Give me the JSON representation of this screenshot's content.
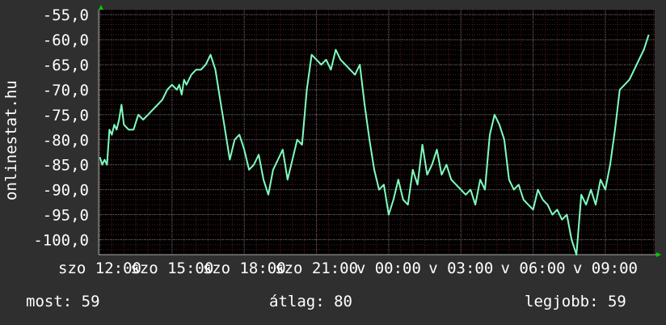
{
  "chart_data": {
    "type": "line",
    "ylabel": "onlinestat.hu",
    "y_ticks": [
      "-55,0",
      "-60,0",
      "-65,0",
      "-70,0",
      "-75,0",
      "-80,0",
      "-85,0",
      "-90,0",
      "-95,0",
      "-100,0"
    ],
    "y_tick_values": [
      -55,
      -60,
      -65,
      -70,
      -75,
      -80,
      -85,
      -90,
      -95,
      -100
    ],
    "ylim": [
      -103,
      -54
    ],
    "x_ticks": [
      "szo 12:00",
      "szo 15:00",
      "szo 18:00",
      "szo 21:00",
      "v 00:00",
      "v 03:00",
      "v 06:00",
      "v 09:00"
    ],
    "x_tick_hours": [
      12,
      15,
      18,
      21,
      24,
      27,
      30,
      33
    ],
    "xlim_hours": [
      11.95,
      35.05
    ],
    "grid": true,
    "series": [
      {
        "color": "#7fffbf",
        "x_hours": [
          12.0,
          12.1,
          12.2,
          12.3,
          12.4,
          12.5,
          12.6,
          12.7,
          12.8,
          12.9,
          13.0,
          13.2,
          13.4,
          13.6,
          13.8,
          14.0,
          14.2,
          14.4,
          14.6,
          14.8,
          15.0,
          15.2,
          15.3,
          15.4,
          15.5,
          15.6,
          15.8,
          16.0,
          16.2,
          16.4,
          16.6,
          16.8,
          17.0,
          17.2,
          17.4,
          17.6,
          17.8,
          18.0,
          18.2,
          18.4,
          18.6,
          18.8,
          19.0,
          19.2,
          19.4,
          19.6,
          19.8,
          20.0,
          20.2,
          20.4,
          20.6,
          20.8,
          21.0,
          21.2,
          21.4,
          21.6,
          21.8,
          22.0,
          22.2,
          22.4,
          22.6,
          22.8,
          23.0,
          23.2,
          23.4,
          23.6,
          23.8,
          24.0,
          24.2,
          24.4,
          24.6,
          24.8,
          25.0,
          25.2,
          25.4,
          25.6,
          25.8,
          26.0,
          26.2,
          26.4,
          26.6,
          26.8,
          27.0,
          27.2,
          27.4,
          27.6,
          27.8,
          28.0,
          28.2,
          28.4,
          28.6,
          28.8,
          29.0,
          29.2,
          29.4,
          29.6,
          29.8,
          30.0,
          30.2,
          30.4,
          30.6,
          30.8,
          31.0,
          31.2,
          31.4,
          31.6,
          31.8,
          32.0,
          32.2,
          32.4,
          32.6,
          32.8,
          33.0,
          33.2,
          33.4,
          33.6,
          33.8,
          34.0,
          34.2,
          34.4,
          34.6,
          34.8,
          35.0
        ],
        "y": [
          -83.5,
          -85,
          -84,
          -85,
          -78,
          -79,
          -77,
          -78,
          -76,
          -73,
          -77,
          -78,
          -78,
          -75,
          -76,
          -75,
          -74,
          -73,
          -72,
          -70,
          -69,
          -70,
          -69,
          -71,
          -68,
          -69,
          -67,
          -66,
          -66,
          -65,
          -63,
          -66,
          -72,
          -78,
          -84,
          -80,
          -79,
          -82,
          -86,
          -85,
          -83,
          -88,
          -91,
          -86,
          -84,
          -82,
          -88,
          -84,
          -80,
          -81,
          -70,
          -63,
          -64,
          -65,
          -64,
          -66,
          -62,
          -64,
          -65,
          -66,
          -67,
          -65,
          -73,
          -80,
          -86,
          -90,
          -89,
          -95,
          -92,
          -88,
          -92,
          -93,
          -86,
          -89,
          -81,
          -87,
          -85,
          -82,
          -87,
          -85,
          -88,
          -89,
          -90,
          -91,
          -90,
          -93,
          -88,
          -90,
          -79,
          -75,
          -77,
          -80,
          -88,
          -90,
          -89,
          -92,
          -93,
          -94,
          -90,
          -92,
          -93,
          -95,
          -94,
          -96,
          -95,
          -100,
          -103,
          -91,
          -93,
          -90,
          -93,
          -88,
          -90,
          -85,
          -78,
          -70,
          -69,
          -68,
          -66,
          -64,
          -62,
          -59
        ]
      }
    ]
  },
  "footer": {
    "now": "most: 59",
    "avg": "átlag: 80",
    "best": "legjobb: 59"
  },
  "colors": {
    "background": "#2f2f2f",
    "plot_background": "#000000",
    "line": "#7fffbf",
    "minor_grid": "#5a1e1e",
    "major_grid": "#666666",
    "axis_arrow": "#00cc00"
  }
}
